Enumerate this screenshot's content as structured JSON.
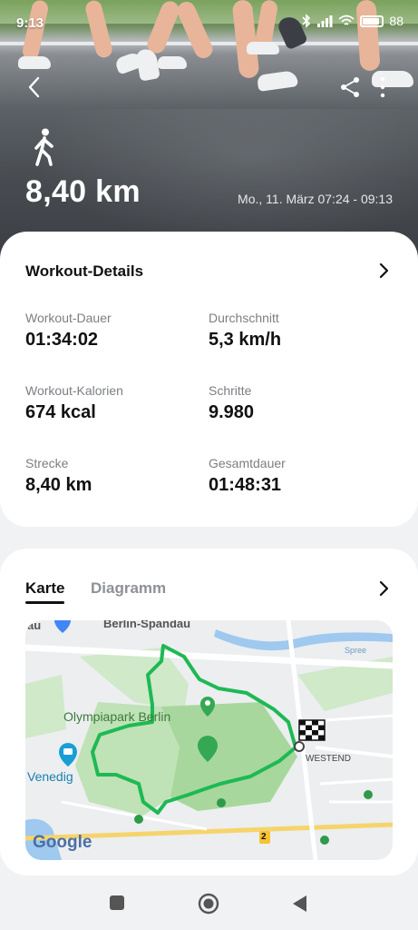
{
  "status_bar": {
    "time": "9:13",
    "battery": "88"
  },
  "header": {
    "distance": "8,40 km",
    "date_range": "Mo., 11. März 07:24 - 09:13"
  },
  "workout_details": {
    "title": "Workout-Details",
    "metrics": [
      {
        "label": "Workout-Dauer",
        "value": "01:34:02"
      },
      {
        "label": "Durchschnitt",
        "value": "5,3 km/h"
      },
      {
        "label": "Workout-Kalorien",
        "value": "674 kcal"
      },
      {
        "label": "Schritte",
        "value": "9.980"
      },
      {
        "label": "Strecke",
        "value": "8,40 km"
      },
      {
        "label": "Gesamtdauer",
        "value": "01:48:31"
      }
    ]
  },
  "map_section": {
    "tabs": [
      {
        "label": "Karte"
      },
      {
        "label": "Diagramm"
      }
    ],
    "map_labels": {
      "spandau": "Berlin-Spandau",
      "au": "au",
      "park": "Olympiapark Berlin",
      "westend": "WESTEND",
      "venedig": "Venedig",
      "spree": "Spree",
      "google": "Google",
      "road_number": "2"
    }
  },
  "colors": {
    "route": "#1db954",
    "accent": "#111111",
    "park_green": "#cfe9c9",
    "water": "#9fc9ef"
  }
}
